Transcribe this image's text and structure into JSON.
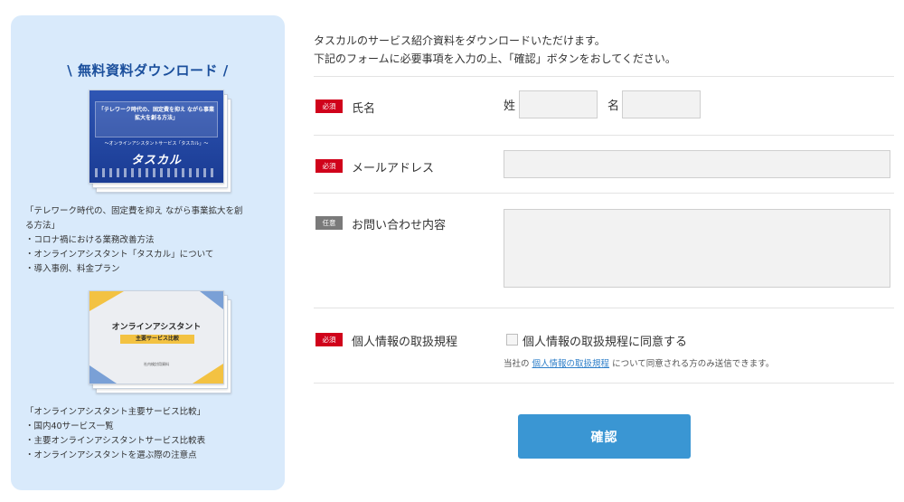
{
  "sidebar": {
    "title": "\\ 無料資料ダウンロード /",
    "doc1": {
      "cover_title": "「テレワーク時代の、固定費を抑え ながら事業拡大を創る方法」",
      "cover_subtitle": "〜オンラインアシスタントサービス「タスカル」〜",
      "cover_brand": "タスカル",
      "desc": [
        "「テレワーク時代の、固定費を抑え ながら事業拡大を創",
        "る方法」",
        "・コロナ禍における業務改善方法",
        "・オンラインアシスタント「タスカル」について",
        "・導入事例、料金プラン"
      ]
    },
    "doc2": {
      "cover_title": "オンラインアシスタント",
      "cover_tag": "主要サービス比較",
      "cover_footer": "社内検討用資料",
      "desc": [
        "「オンラインアシスタント主要サービス比較」",
        "・国内40サービス一覧",
        "・主要オンラインアシスタントサービス比較表",
        "・オンラインアシスタントを選ぶ際の注意点"
      ]
    }
  },
  "intro": [
    "タスカルのサービス紹介資料をダウンロードいただけます。",
    "下記のフォームに必要事項を入力の上、「確認」ボタンをおしてください。"
  ],
  "form": {
    "name": {
      "badge": "必須",
      "label": "氏名",
      "sei_label": "姓",
      "mei_label": "名",
      "sei_value": "",
      "mei_value": ""
    },
    "email": {
      "badge": "必須",
      "label": "メールアドレス",
      "value": ""
    },
    "inquiry": {
      "badge": "任意",
      "label": "お問い合わせ内容",
      "value": ""
    },
    "privacy": {
      "badge": "必須",
      "label": "個人情報の取扱規程",
      "checkbox_label": "個人情報の取扱規程に同意する",
      "consent_prefix": "当社の",
      "consent_link": "個人情報の取扱規程",
      "consent_suffix": "について同意される方のみ送信できます。",
      "checked": false
    },
    "submit_label": "確認"
  },
  "colors": {
    "sidebar_bg": "#d9eafb",
    "title": "#1b4f9c",
    "required": "#d0021b",
    "optional": "#7a7a7a",
    "link": "#2e7fc9",
    "button": "#3a96d3"
  }
}
